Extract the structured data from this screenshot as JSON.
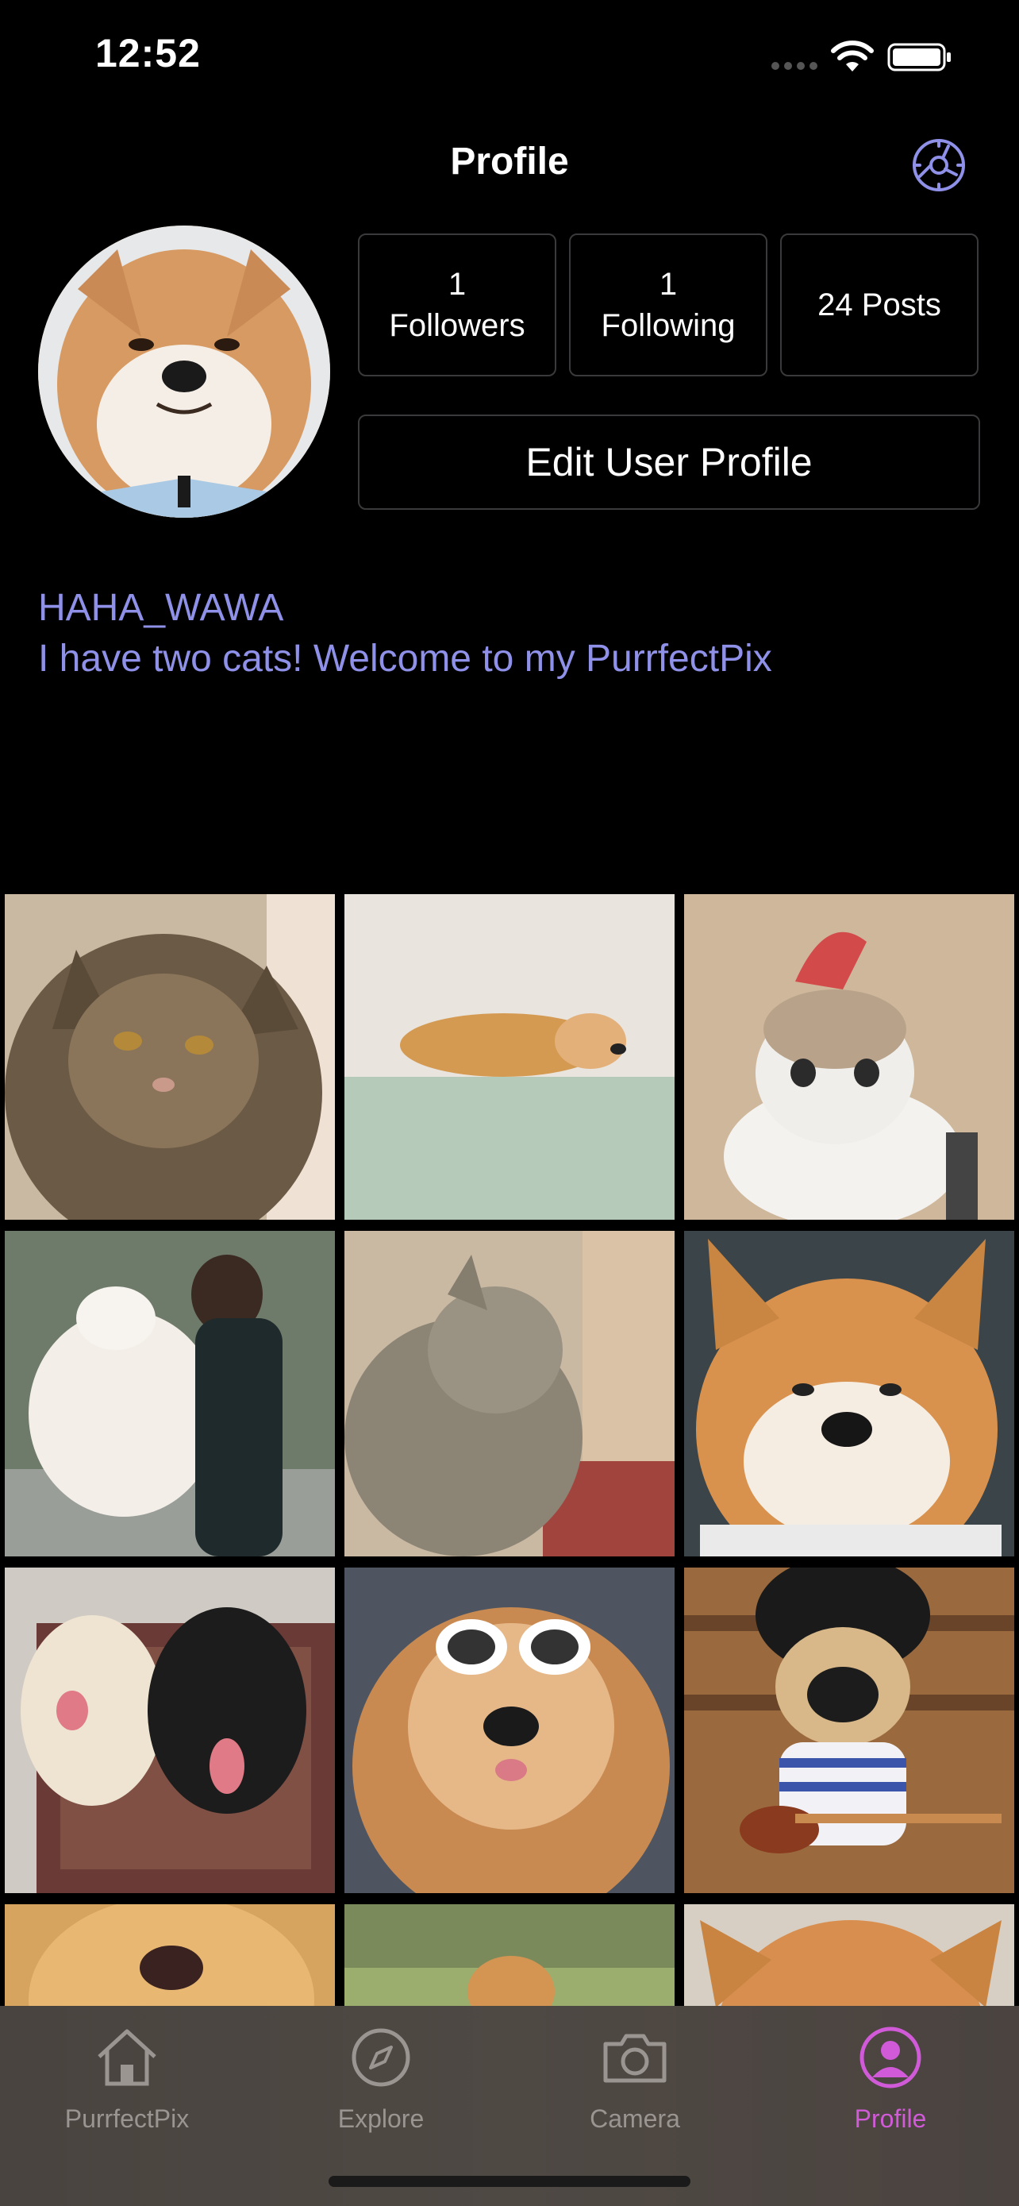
{
  "status_bar": {
    "time": "12:52"
  },
  "header": {
    "title": "Profile",
    "settings_icon": "gear-icon"
  },
  "profile": {
    "followers": {
      "count": "1",
      "label": "Followers"
    },
    "following": {
      "count": "1",
      "label": "Following"
    },
    "posts": {
      "label": "24 Posts"
    },
    "edit_button": "Edit User Profile",
    "username": "HAHA_WAWA",
    "bio": "I have two cats! Welcome to my PurrfectPix"
  },
  "grid": {
    "photos": [
      "tabby cat",
      "shiba in bathtub",
      "kitten with flamingo hat",
      "man holding fluffy dog",
      "grey cat by window",
      "shiba inu portrait",
      "two dogs on rug",
      "chow chow with sunglasses",
      "pug with guitar",
      "golden retriever",
      "corgi on grass",
      "shiba close-up"
    ]
  },
  "tab_bar": {
    "tabs": [
      {
        "label": "PurrfectPix",
        "icon": "home-icon",
        "active": false
      },
      {
        "label": "Explore",
        "icon": "compass-icon",
        "active": false
      },
      {
        "label": "Camera",
        "icon": "camera-icon",
        "active": false
      },
      {
        "label": "Profile",
        "icon": "profile-icon",
        "active": true
      }
    ],
    "active_color": "#d05ad8",
    "inactive_color": "#9a9590"
  },
  "colors": {
    "accent": "#8f90e8",
    "background": "#000000"
  }
}
